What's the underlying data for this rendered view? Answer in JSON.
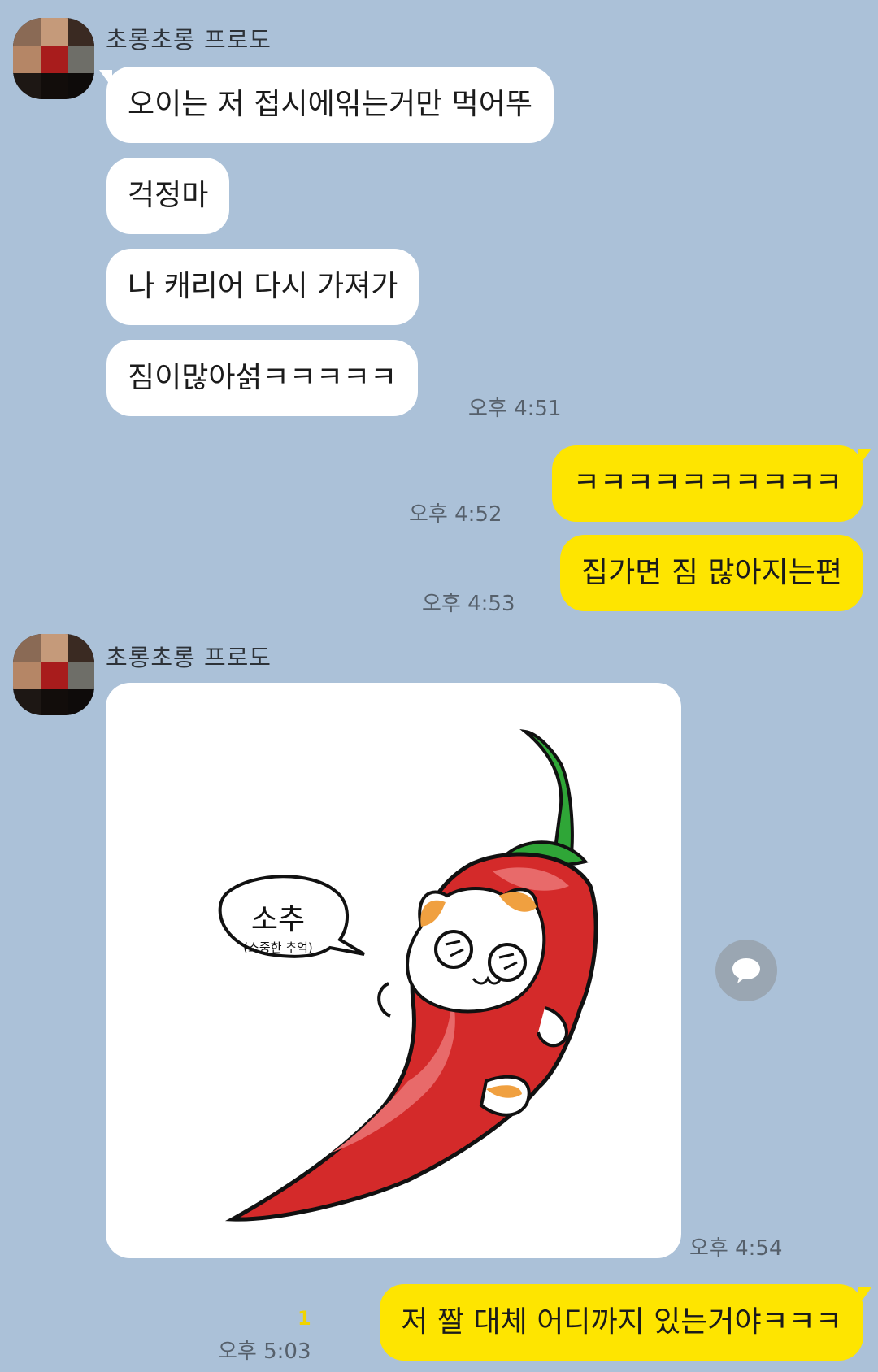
{
  "chat": {
    "groups": [
      {
        "sender": "초롱초롱 프로도",
        "messages": [
          "오이는 저 접시에읶는거만 먹어뚜",
          "걱정마",
          "나 캐리어 다시 가져가",
          "짐이많아섥ㅋㅋㅋㅋㅋ"
        ],
        "time": "오후 4:51"
      },
      {
        "sender": "초롱초롱 프로도",
        "image": {
          "bubble_text": "소추",
          "bubble_subtext": "(소중한 추억)"
        },
        "time": "오후 4:54"
      }
    ],
    "outgoing": [
      {
        "text": "ㅋㅋㅋㅋㅋㅋㅋㅋㅋㅋ",
        "time": "오후 4:52"
      },
      {
        "text": "집가면 짐 많아지는편",
        "time": "오후 4:53"
      },
      {
        "text": "저 짤 대체 어디까지 있는거야ㅋㅋㅋ",
        "time": "오후 5:03",
        "unread": "1"
      }
    ]
  },
  "colors": {
    "background": "#abc1d8",
    "incoming_bubble": "#ffffff",
    "outgoing_bubble": "#fee500",
    "unread": "#f0d400"
  },
  "icons": [
    "avatar",
    "share-icon"
  ]
}
